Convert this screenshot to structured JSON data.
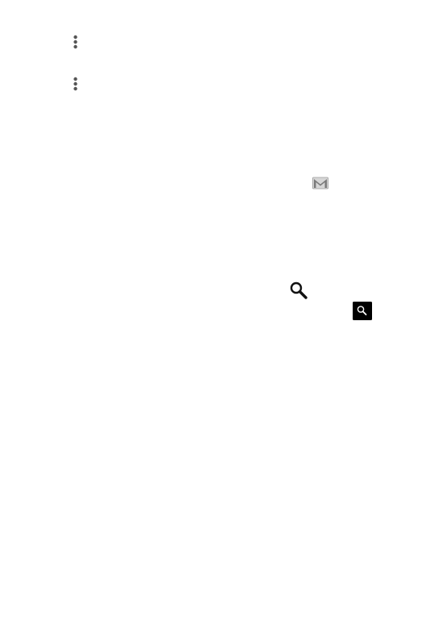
{
  "icons": [
    {
      "id": "overflow-menu-1",
      "name": "overflow-menu-icon",
      "glyph": "more-vertical",
      "color": "#555555"
    },
    {
      "id": "overflow-menu-2",
      "name": "overflow-menu-icon",
      "glyph": "more-vertical",
      "color": "#555555"
    },
    {
      "id": "gmail",
      "name": "gmail-icon",
      "glyph": "envelope-m",
      "color": "#888888"
    },
    {
      "id": "search",
      "name": "search-icon",
      "glyph": "magnifier",
      "color": "#000000"
    },
    {
      "id": "search-button",
      "name": "search-button-icon",
      "glyph": "magnifier-boxed",
      "color": "#000000"
    }
  ]
}
